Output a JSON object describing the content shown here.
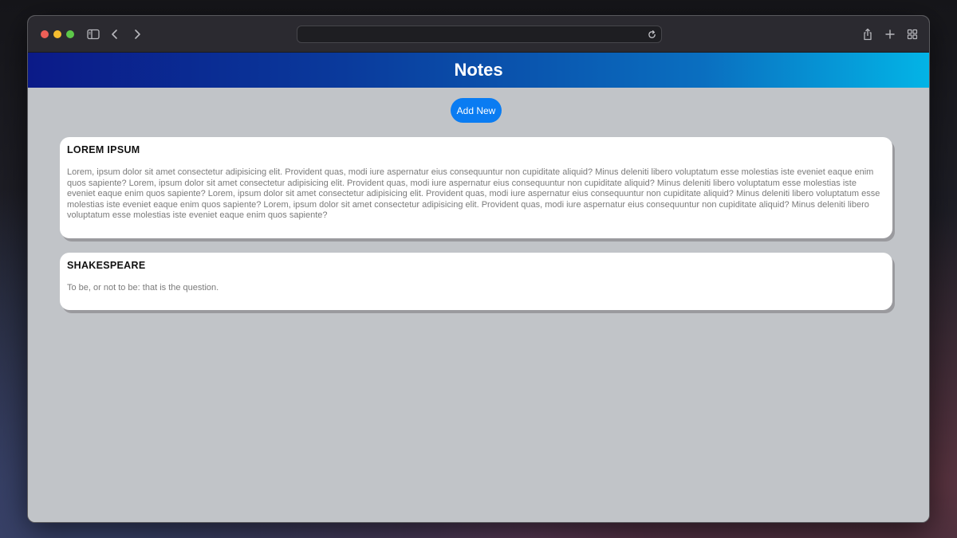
{
  "browser": {
    "address_bar_value": ""
  },
  "app": {
    "title": "Notes",
    "add_button_label": "Add New"
  },
  "notes": [
    {
      "title": "LOREM IPSUM",
      "body": "Lorem, ipsum dolor sit amet consectetur adipisicing elit. Provident quas, modi iure aspernatur eius consequuntur non cupiditate aliquid? Minus deleniti libero voluptatum esse molestias iste eveniet eaque enim quos sapiente? Lorem, ipsum dolor sit amet consectetur adipisicing elit. Provident quas, modi iure aspernatur eius consequuntur non cupiditate aliquid? Minus deleniti libero voluptatum esse molestias iste eveniet eaque enim quos sapiente? Lorem, ipsum dolor sit amet consectetur adipisicing elit. Provident quas, modi iure aspernatur eius consequuntur non cupiditate aliquid? Minus deleniti libero voluptatum esse molestias iste eveniet eaque enim quos sapiente? Lorem, ipsum dolor sit amet consectetur adipisicing elit. Provident quas, modi iure aspernatur eius consequuntur non cupiditate aliquid? Minus deleniti libero voluptatum esse molestias iste eveniet eaque enim quos sapiente?"
    },
    {
      "title": "SHAKESPEARE",
      "body": "To be, or not to be: that is the question."
    }
  ],
  "icons": {
    "sidebar": "sidebar-icon",
    "back": "chevron-left-icon",
    "forward": "chevron-right-icon",
    "reload": "reload-icon",
    "share": "share-icon",
    "new_tab": "plus-icon",
    "tab_overview": "tab-grid-icon"
  },
  "colors": {
    "header_gradient_start": "#0b1a88",
    "header_gradient_end": "#03b4e6",
    "accent_button": "#0a7cf2",
    "page_background": "#c1c4c8",
    "card_background": "#ffffff",
    "traffic_close": "#ee5f57",
    "traffic_minimize": "#f5bc2f",
    "traffic_maximize": "#5dc849"
  }
}
